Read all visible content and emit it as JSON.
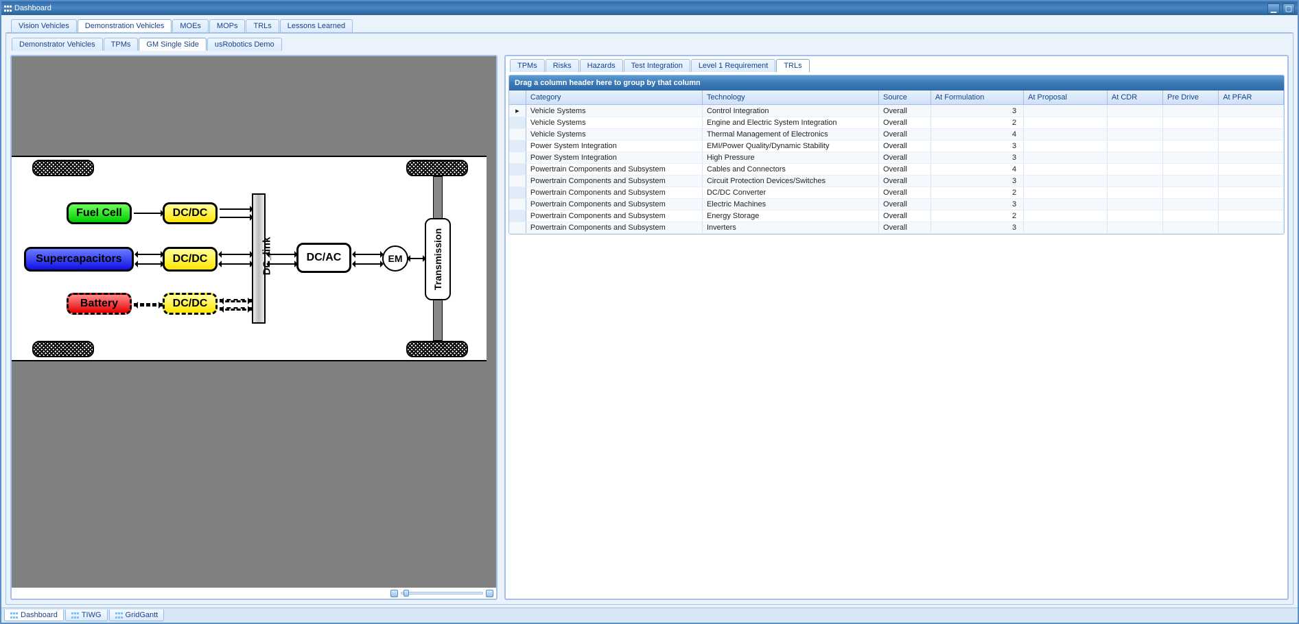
{
  "window": {
    "title": "Dashboard"
  },
  "topTabs": [
    {
      "label": "Vision Vehicles",
      "active": false
    },
    {
      "label": "Demonstration Vehicles",
      "active": true
    },
    {
      "label": "MOEs",
      "active": false
    },
    {
      "label": "MOPs",
      "active": false
    },
    {
      "label": "TRLs",
      "active": false
    },
    {
      "label": "Lessons Learned",
      "active": false
    }
  ],
  "subTabs": [
    {
      "label": "Demonstrator Vehicles",
      "active": false
    },
    {
      "label": "TPMs",
      "active": false
    },
    {
      "label": "GM Single Side",
      "active": true
    },
    {
      "label": "usRobotics Demo",
      "active": false
    }
  ],
  "rightTabs": [
    {
      "label": "TPMs",
      "active": false
    },
    {
      "label": "Risks",
      "active": false
    },
    {
      "label": "Hazards",
      "active": false
    },
    {
      "label": "Test Integration",
      "active": false
    },
    {
      "label": "Level 1 Requirement",
      "active": false
    },
    {
      "label": "TRLs",
      "active": true
    }
  ],
  "groupBarText": "Drag a column header here to group by that column",
  "grid": {
    "columns": [
      "Category",
      "Technology",
      "Source",
      "At Formulation",
      "At Proposal",
      "At CDR",
      "Pre Drive",
      "At PFAR"
    ],
    "rows": [
      {
        "category": "Vehicle Systems",
        "technology": "Control Integration",
        "source": "Overall",
        "atFormulation": 3
      },
      {
        "category": "Vehicle Systems",
        "technology": "Engine and Electric System Integration",
        "source": "Overall",
        "atFormulation": 2
      },
      {
        "category": "Vehicle Systems",
        "technology": "Thermal Management of Electronics",
        "source": "Overall",
        "atFormulation": 4
      },
      {
        "category": "Power System Integration",
        "technology": "EMI/Power Quality/Dynamic Stability",
        "source": "Overall",
        "atFormulation": 3
      },
      {
        "category": "Power System Integration",
        "technology": "High Pressure",
        "source": "Overall",
        "atFormulation": 3
      },
      {
        "category": "Powertrain Components and Subsystem",
        "technology": "Cables and Connectors",
        "source": "Overall",
        "atFormulation": 4
      },
      {
        "category": "Powertrain Components and Subsystem",
        "technology": "Circuit Protection Devices/Switches",
        "source": "Overall",
        "atFormulation": 3
      },
      {
        "category": "Powertrain Components and Subsystem",
        "technology": "DC/DC Converter",
        "source": "Overall",
        "atFormulation": 2
      },
      {
        "category": "Powertrain Components and Subsystem",
        "technology": "Electric Machines",
        "source": "Overall",
        "atFormulation": 3
      },
      {
        "category": "Powertrain Components and Subsystem",
        "technology": "Energy Storage",
        "source": "Overall",
        "atFormulation": 2
      },
      {
        "category": "Powertrain Components and Subsystem",
        "technology": "Inverters",
        "source": "Overall",
        "atFormulation": 3
      }
    ]
  },
  "diagram": {
    "fuelCell": "Fuel Cell",
    "dcdc": "DC/DC",
    "supercaps": "Supercapacitors",
    "battery": "Battery",
    "dclink": "DC_link",
    "dcac": "DC/AC",
    "em": "EM",
    "transmission": "Transmission"
  },
  "bottomTabs": [
    {
      "label": "Dashboard",
      "active": true
    },
    {
      "label": "TIWG",
      "active": false
    },
    {
      "label": "GridGantt",
      "active": false
    }
  ]
}
